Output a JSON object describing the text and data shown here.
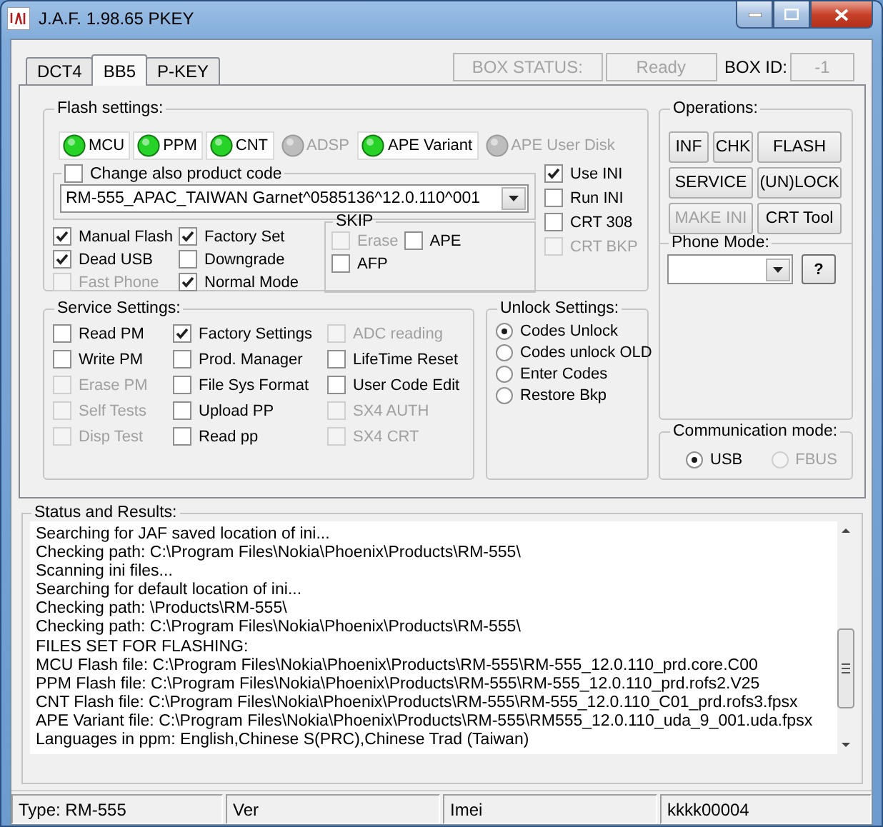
{
  "window": {
    "title": "J.A.F.  1.98.65 PKEY"
  },
  "tabs": [
    {
      "label": "DCT4",
      "selected": false
    },
    {
      "label": "BB5",
      "selected": true
    },
    {
      "label": "P-KEY",
      "selected": false
    }
  ],
  "box_status": {
    "label": "BOX STATUS:",
    "value": "Ready",
    "id_label": "BOX ID:",
    "id_value": "-1"
  },
  "flash_settings": {
    "title": "Flash settings:",
    "indicators": [
      {
        "label": "MCU",
        "on": true
      },
      {
        "label": "PPM",
        "on": true
      },
      {
        "label": "CNT",
        "on": true
      },
      {
        "label": "ADSP",
        "on": false
      },
      {
        "label": "APE Variant",
        "on": true
      },
      {
        "label": "APE User Disk",
        "on": false
      }
    ],
    "product_code": {
      "label": "Change also product code",
      "checked": false,
      "value": "RM-555_APAC_TAIWAN Garnet^0585136^12.0.110^001"
    },
    "ini_options": [
      {
        "label": "Use INI",
        "checked": true,
        "disabled": false
      },
      {
        "label": "Run INI",
        "checked": false,
        "disabled": false
      },
      {
        "label": "CRT 308",
        "checked": false,
        "disabled": false
      },
      {
        "label": "CRT BKP",
        "checked": false,
        "disabled": true
      }
    ],
    "option_columns": [
      {
        "items": [
          {
            "label": "Manual Flash",
            "checked": true,
            "disabled": false
          },
          {
            "label": "Dead USB",
            "checked": true,
            "disabled": false
          },
          {
            "label": "Fast Phone",
            "checked": false,
            "disabled": true
          }
        ]
      },
      {
        "items": [
          {
            "label": "Factory Set",
            "checked": true,
            "disabled": false
          },
          {
            "label": "Downgrade",
            "checked": false,
            "disabled": false
          },
          {
            "label": "Normal Mode",
            "checked": true,
            "disabled": false
          }
        ]
      }
    ],
    "skip": {
      "title": "SKIP",
      "items": [
        {
          "label": "Erase",
          "checked": false,
          "disabled": true
        },
        {
          "label": "APE",
          "checked": false,
          "disabled": false
        },
        {
          "label": "AFP",
          "checked": false,
          "disabled": false
        }
      ]
    }
  },
  "service_settings": {
    "title": "Service Settings:",
    "columns": [
      {
        "items": [
          {
            "label": "Read PM",
            "checked": false,
            "disabled": false
          },
          {
            "label": "Write PM",
            "checked": false,
            "disabled": false
          },
          {
            "label": "Erase PM",
            "checked": false,
            "disabled": true
          },
          {
            "label": "Self Tests",
            "checked": false,
            "disabled": true
          },
          {
            "label": "Disp Test",
            "checked": false,
            "disabled": true
          }
        ]
      },
      {
        "items": [
          {
            "label": "Factory Settings",
            "checked": true,
            "disabled": false
          },
          {
            "label": "Prod. Manager",
            "checked": false,
            "disabled": false
          },
          {
            "label": "File Sys Format",
            "checked": false,
            "disabled": false
          },
          {
            "label": "Upload PP",
            "checked": false,
            "disabled": false
          },
          {
            "label": "Read pp",
            "checked": false,
            "disabled": false
          }
        ]
      },
      {
        "items": [
          {
            "label": "ADC reading",
            "checked": false,
            "disabled": true
          },
          {
            "label": "LifeTime Reset",
            "checked": false,
            "disabled": false
          },
          {
            "label": "User Code Edit",
            "checked": false,
            "disabled": false
          },
          {
            "label": "SX4 AUTH",
            "checked": false,
            "disabled": true
          },
          {
            "label": "SX4 CRT",
            "checked": false,
            "disabled": true
          }
        ]
      }
    ]
  },
  "unlock_settings": {
    "title": "Unlock Settings:",
    "options": [
      {
        "label": "Codes Unlock",
        "selected": true
      },
      {
        "label": "Codes unlock OLD",
        "selected": false
      },
      {
        "label": "Enter Codes",
        "selected": false
      },
      {
        "label": "Restore Bkp",
        "selected": false
      }
    ]
  },
  "operations": {
    "title": "Operations:",
    "button_rows": [
      [
        {
          "label": "INF",
          "disabled": false
        },
        {
          "label": "CHK",
          "disabled": false
        },
        {
          "label": "FLASH",
          "disabled": false
        }
      ],
      [
        {
          "label": "SERVICE",
          "disabled": false
        },
        {
          "label": "(UN)LOCK",
          "disabled": false
        }
      ],
      [
        {
          "label": "MAKE INI",
          "disabled": true
        },
        {
          "label": "CRT Tool",
          "disabled": false
        }
      ]
    ],
    "phone_mode": {
      "title": "Phone Mode:",
      "help": "?"
    }
  },
  "communication_mode": {
    "title": "Communication mode:",
    "options": [
      {
        "label": "USB",
        "selected": true,
        "disabled": false
      },
      {
        "label": "FBUS",
        "selected": false,
        "disabled": true
      }
    ]
  },
  "status_results": {
    "title": "Status and Results:",
    "lines": [
      "Searching for JAF saved location of ini...",
      "Checking path: C:\\Program Files\\Nokia\\Phoenix\\Products\\RM-555\\",
      "Scanning ini files...",
      "Searching for default location of ini...",
      "Checking path: \\Products\\RM-555\\",
      "Checking path: C:\\Program Files\\Nokia\\Phoenix\\Products\\RM-555\\",
      "FILES SET FOR FLASHING:",
      "MCU Flash file: C:\\Program Files\\Nokia\\Phoenix\\Products\\RM-555\\RM-555_12.0.110_prd.core.C00",
      "PPM Flash file: C:\\Program Files\\Nokia\\Phoenix\\Products\\RM-555\\RM-555_12.0.110_prd.rofs2.V25",
      "CNT Flash file: C:\\Program Files\\Nokia\\Phoenix\\Products\\RM-555\\RM-555_12.0.110_C01_prd.rofs3.fpsx",
      "APE Variant file: C:\\Program Files\\Nokia\\Phoenix\\Products\\RM-555\\RM555_12.0.110_uda_9_001.uda.fpsx",
      "Languages in ppm: English,Chinese S(PRC),Chinese Trad (Taiwan)"
    ]
  },
  "status_bar": [
    "Type: RM-555",
    "Ver",
    "Imei",
    "kkkk00004"
  ]
}
